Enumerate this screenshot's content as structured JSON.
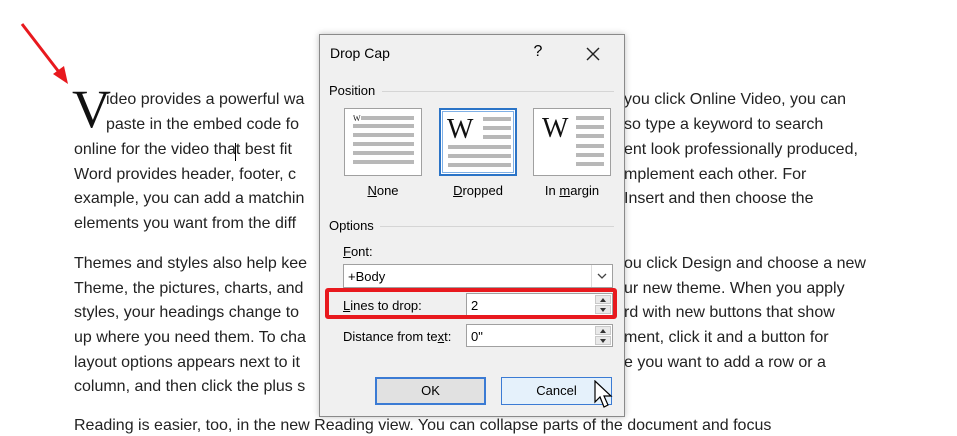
{
  "document": {
    "drop_cap": "V",
    "lines": [
      "ideo provides a powerful wa",
      "paste in the embed code fo",
      "online for the video that best fit",
      "Word provides header, footer, c",
      "example, you can add a matchin",
      "elements you want from the diff",
      "Themes and styles also help kee",
      "Theme, the pictures, charts, and",
      "styles, your headings change to",
      "up where you need them. To cha",
      "layout options appears next to it",
      "column, and then click the plus s",
      "Reading is easier, too, in the new Reading view. You can collapse parts of the document and focus"
    ],
    "right_lines": [
      "you click Online Video, you can",
      "so type a keyword to search",
      "ent look professionally produced,",
      "mplement each other. For",
      "Insert and then choose the",
      "",
      "ou click Design and choose a new",
      "ur new theme. When you apply",
      "rd with new buttons that show",
      "ment, click it and a button for",
      "e you want to add a row or a",
      ""
    ]
  },
  "dialog": {
    "title": "Drop Cap",
    "help_label": "?",
    "position_group": "Position",
    "options": [
      {
        "label_pre": "",
        "label_ul": "N",
        "label_post": "one",
        "preview_letter": "W"
      },
      {
        "label_pre": "",
        "label_ul": "D",
        "label_post": "ropped",
        "preview_letter": "W"
      },
      {
        "label_pre": "In ",
        "label_ul": "m",
        "label_post": "argin",
        "preview_letter": "W"
      }
    ],
    "selected_option": "Dropped",
    "options_group": "Options",
    "font_label_ul": "F",
    "font_label_post": "ont:",
    "font_value": "+Body",
    "lines_label_ul": "L",
    "lines_label_post": "ines to drop:",
    "lines_value": "2",
    "distance_label_pre": "Distance from te",
    "distance_label_ul": "x",
    "distance_label_post": "t:",
    "distance_value": "0\"",
    "ok_label": "OK",
    "cancel_label": "Cancel"
  },
  "colors": {
    "highlight": "#e8191e",
    "arrow": "#e8191e",
    "selected_border": "#2b74c7"
  }
}
